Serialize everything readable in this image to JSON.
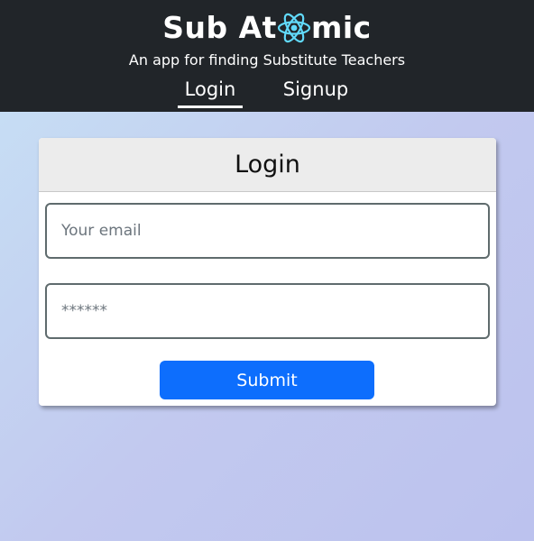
{
  "header": {
    "brand_before": "Sub At",
    "brand_icon": "react-atom-icon",
    "brand_after": "mic",
    "tagline": "An app for finding Substitute Teachers",
    "nav": [
      {
        "label": "Login",
        "active": true
      },
      {
        "label": "Signup",
        "active": false
      }
    ]
  },
  "login_card": {
    "title": "Login",
    "email_placeholder": "Your email",
    "password_placeholder": "******",
    "submit_label": "Submit"
  },
  "colors": {
    "header_bg": "#212529",
    "atom_accent": "#61dafb",
    "submit_bg": "#0d6efd",
    "card_header_bg": "#ececec"
  }
}
